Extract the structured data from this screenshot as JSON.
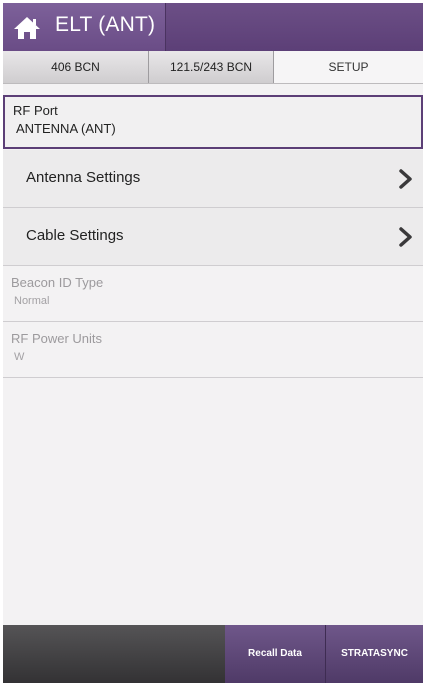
{
  "header": {
    "title": "ELT (ANT)"
  },
  "tabs": [
    {
      "label": "406 BCN"
    },
    {
      "label": "121.5/243 BCN"
    },
    {
      "label": "SETUP"
    }
  ],
  "settings": {
    "rf_port": {
      "label": "RF Port",
      "value": "ANTENNA (ANT)"
    },
    "antenna_settings": {
      "label": "Antenna Settings"
    },
    "cable_settings": {
      "label": "Cable Settings"
    },
    "beacon_id_type": {
      "label": "Beacon ID Type",
      "value": "Normal"
    },
    "rf_power_units": {
      "label": "RF Power Units",
      "value": "W"
    }
  },
  "bottom_bar": {
    "recall_data": "Recall Data",
    "stratasync": "STRATASYNC"
  },
  "colors": {
    "accent": "#5c3f77",
    "title_text": "#ffffff"
  }
}
